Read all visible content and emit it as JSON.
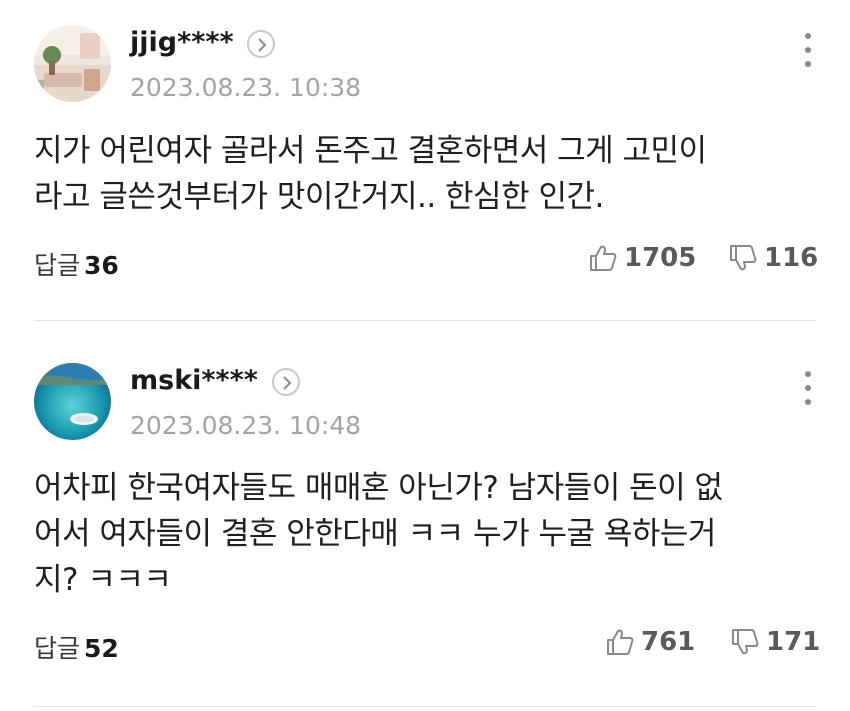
{
  "comments": [
    {
      "username": "jjig****",
      "timestamp": "2023.08.23. 10:38",
      "text": "지가 어린여자 골라서 돈주고 결혼하면서 그게 고민이\n라고 글쓴것부터가 맛이간거지.. 한심한 인간.",
      "reply_label": "답글",
      "reply_count": "36",
      "likes": "1705",
      "dislikes": "116"
    },
    {
      "username": "mski****",
      "timestamp": "2023.08.23. 10:48",
      "text": "어차피 한국여자들도 매매혼 아닌가? 남자들이 돈이 없\n어서 여자들이 결혼 안한다매 ㅋㅋ 누가 누굴 욕하는거\n지? ㅋㅋㅋ",
      "reply_label": "답글",
      "reply_count": "52",
      "likes": "761",
      "dislikes": "171"
    }
  ],
  "icons": {
    "profile_arrow": "chevron-right-icon",
    "more": "vertical-dots-icon",
    "like": "thumbs-up-icon",
    "dislike": "thumbs-down-icon"
  },
  "colors": {
    "text": "#1f1f1f",
    "muted": "#a3a3a3",
    "icon": "#8a8a8a",
    "divider": "#e4e4e4"
  }
}
